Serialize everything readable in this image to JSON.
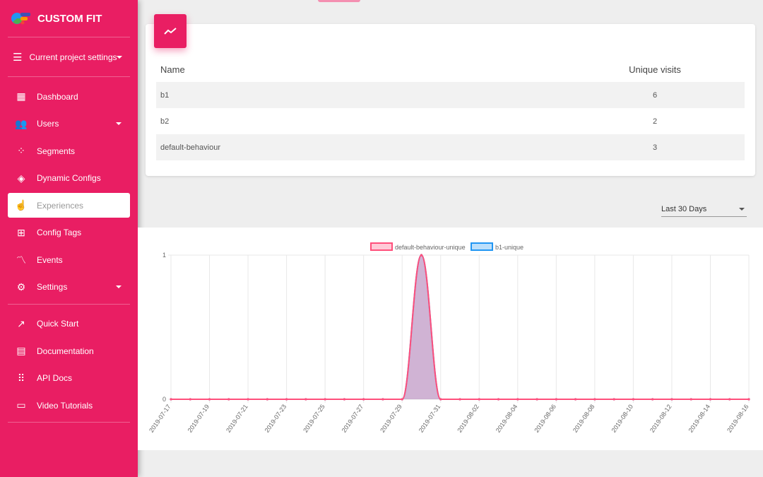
{
  "brand": {
    "name": "CUSTOM FIT"
  },
  "project_settings": {
    "label": "Current project settings"
  },
  "nav": [
    {
      "label": "Dashboard",
      "icon": "dashboard-icon"
    },
    {
      "label": "Users",
      "icon": "users-icon",
      "caret": true
    },
    {
      "label": "Segments",
      "icon": "segments-icon"
    },
    {
      "label": "Dynamic Configs",
      "icon": "dynamic-configs-icon"
    },
    {
      "label": "Experiences",
      "icon": "touch-icon",
      "active": true
    },
    {
      "label": "Config Tags",
      "icon": "config-tags-icon"
    },
    {
      "label": "Events",
      "icon": "events-icon"
    },
    {
      "label": "Settings",
      "icon": "gear-icon",
      "caret": true
    }
  ],
  "nav2": [
    {
      "label": "Quick Start",
      "icon": "external-link-icon"
    },
    {
      "label": "Documentation",
      "icon": "document-icon"
    },
    {
      "label": "API Docs",
      "icon": "grid-icon"
    },
    {
      "label": "Video Tutorials",
      "icon": "monitor-icon"
    }
  ],
  "table": {
    "headers": [
      "Name",
      "Unique visits"
    ],
    "rows": [
      [
        "b1",
        "6"
      ],
      [
        "b2",
        "2"
      ],
      [
        "default-behaviour",
        "3"
      ]
    ]
  },
  "range_select": {
    "value": "Last 30 Days"
  },
  "chart_data": {
    "type": "area",
    "x": [
      "2019-07-17",
      "2019-07-18",
      "2019-07-19",
      "2019-07-20",
      "2019-07-21",
      "2019-07-22",
      "2019-07-23",
      "2019-07-24",
      "2019-07-25",
      "2019-07-26",
      "2019-07-27",
      "2019-07-28",
      "2019-07-29",
      "2019-07-30",
      "2019-07-31",
      "2019-08-01",
      "2019-08-02",
      "2019-08-03",
      "2019-08-04",
      "2019-08-05",
      "2019-08-06",
      "2019-08-07",
      "2019-08-08",
      "2019-08-09",
      "2019-08-10",
      "2019-08-11",
      "2019-08-12",
      "2019-08-13",
      "2019-08-14",
      "2019-08-15",
      "2019-08-16"
    ],
    "tick_labels": [
      "2019-07-17",
      "2019-07-19",
      "2019-07-21",
      "2019-07-23",
      "2019-07-25",
      "2019-07-27",
      "2019-07-29",
      "2019-07-31",
      "2019-08-02",
      "2019-08-04",
      "2019-08-06",
      "2019-08-08",
      "2019-08-10",
      "2019-08-12",
      "2019-08-14",
      "2019-08-16"
    ],
    "ylim": [
      0,
      1
    ],
    "y_ticks": [
      "0",
      "1"
    ],
    "legend_position": "top",
    "series": [
      {
        "name": "default-behaviour-unique",
        "color": "#ff4f7b",
        "values": [
          0,
          0,
          0,
          0,
          0,
          0,
          0,
          0,
          0,
          0,
          0,
          0,
          0,
          1,
          0,
          0,
          0,
          0,
          0,
          0,
          0,
          0,
          0,
          0,
          0,
          0,
          0,
          0,
          0,
          0,
          0
        ]
      },
      {
        "name": "b1-unique",
        "color": "#2196f3",
        "values": [
          0,
          0,
          0,
          0,
          0,
          0,
          0,
          0,
          0,
          0,
          0,
          0,
          0,
          1,
          0,
          0,
          0,
          0,
          0,
          0,
          0,
          0,
          0,
          0,
          0,
          0,
          0,
          0,
          0,
          0,
          0
        ]
      }
    ]
  }
}
